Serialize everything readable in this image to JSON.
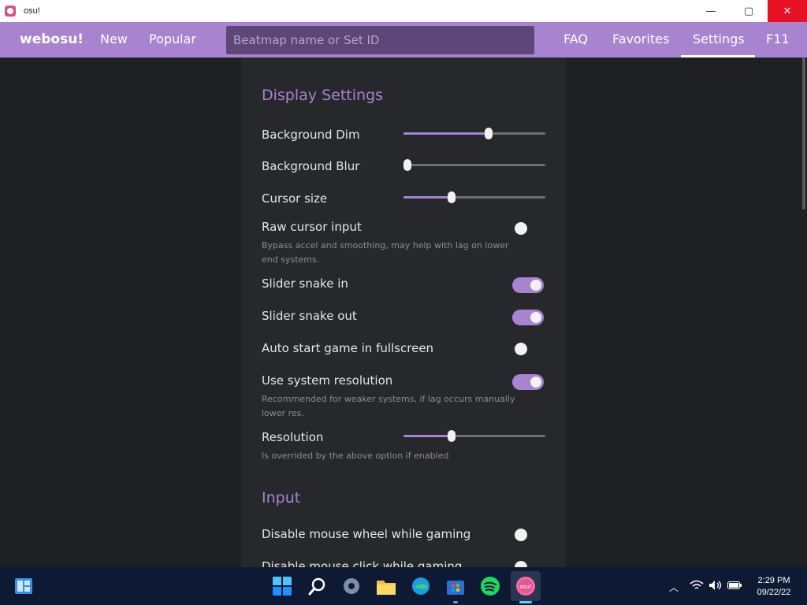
{
  "window": {
    "title": "osu!",
    "minimize": "—",
    "maximize": "▢",
    "close": "✕"
  },
  "nav": {
    "brand": "webosu!",
    "links": {
      "new": "New",
      "popular": "Popular",
      "faq": "FAQ",
      "favorites": "Favorites",
      "settings": "Settings",
      "f11": "F11"
    },
    "search_placeholder": "Beatmap name or Set ID",
    "active": "Settings"
  },
  "display_settings": {
    "title": "Display Settings",
    "background_dim": {
      "label": "Background Dim",
      "value": 0.6
    },
    "background_blur": {
      "label": "Background Blur",
      "value": 0.03
    },
    "cursor_size": {
      "label": "Cursor size",
      "value": 0.34
    },
    "raw_cursor_input": {
      "label": "Raw cursor input",
      "desc": "Bypass accel and smoothing, may help with lag on lower end systems.",
      "on": false
    },
    "slider_snake_in": {
      "label": "Slider snake in",
      "on": true
    },
    "slider_snake_out": {
      "label": "Slider snake out",
      "on": true
    },
    "auto_start_fullscreen": {
      "label": "Auto start game in fullscreen",
      "on": false
    },
    "use_system_resolution": {
      "label": "Use system resolution",
      "desc": "Recommended for weaker systems, if lag occurs manually lower res.",
      "on": true
    },
    "resolution": {
      "label": "Resolution",
      "desc": "Is overrided by the above option if enabled",
      "value": 0.34
    }
  },
  "input_settings": {
    "title": "Input",
    "disable_mouse_wheel": {
      "label": "Disable mouse wheel while gaming",
      "on": false
    },
    "disable_mouse_click": {
      "label": "Disable mouse click while gaming",
      "on": false
    }
  },
  "taskbar": {
    "apps": [
      "widgets-icon",
      "start-icon",
      "search-icon",
      "settings-icon",
      "file-explorer-icon",
      "edge-icon",
      "store-icon",
      "spotify-icon",
      "osu-icon"
    ],
    "time": "2:29 PM",
    "date": "09/22/22"
  },
  "colors": {
    "accent": "#a883cf",
    "panel": "#27282b",
    "background": "#1f2023",
    "close": "#e81123"
  }
}
